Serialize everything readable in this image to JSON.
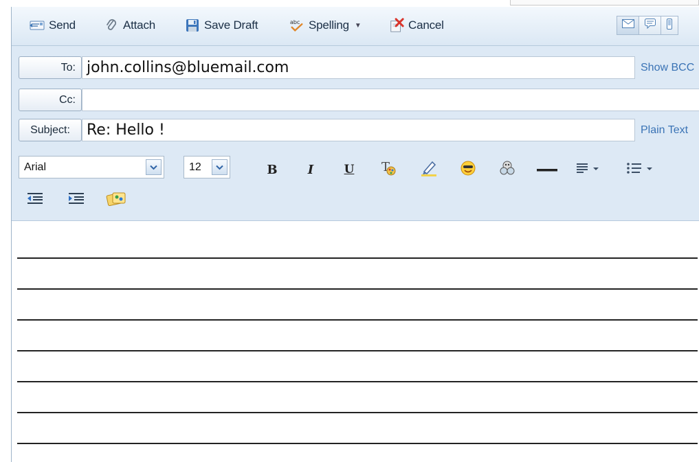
{
  "toolbar": {
    "send_label": "Send",
    "attach_label": "Attach",
    "save_draft_label": "Save Draft",
    "spelling_label": "Spelling",
    "cancel_label": "Cancel",
    "icons": [
      "send-icon",
      "paperclip-icon",
      "floppy-disk-icon",
      "spellcheck-icon",
      "cancel-icon",
      "email-mode-icon",
      "chat-mode-icon",
      "mobile-mode-icon"
    ]
  },
  "header": {
    "to_label": "To:",
    "to_value": "john.collins@bluemail.com",
    "show_bcc_label": "Show BCC",
    "cc_label": "Cc:",
    "cc_value": "",
    "subject_label": "Subject:",
    "subject_value": "Re: Hello !",
    "plain_text_label": "Plain Text"
  },
  "format": {
    "font_value": "Arial",
    "size_value": "12",
    "bold_label": "B",
    "italic_label": "I",
    "underline_label": "U",
    "icons": [
      "text-color-icon",
      "highlighter-icon",
      "emoticon-icon",
      "insert-image-icon",
      "horizontal-rule-icon",
      "align-icon",
      "list-icon",
      "outdent-icon",
      "indent-icon",
      "stationery-icon"
    ]
  },
  "colors": {
    "accent": "#3a73b5",
    "toolbar_bg": "#dbe8f4",
    "header_bg": "#dde9f5"
  },
  "message_body": {
    "line_count": 7
  }
}
